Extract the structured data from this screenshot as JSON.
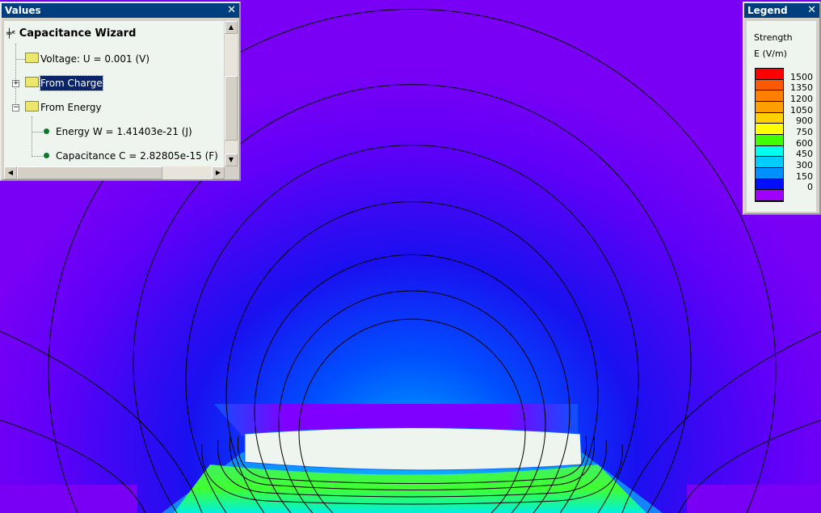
{
  "values_panel": {
    "title": "Values",
    "root": "Capacitance Wizard",
    "root_icon": "capacitor-icon",
    "items": [
      {
        "label": "Voltage: U = 0.001 (V)",
        "icon": "folder-icon"
      },
      {
        "label": "From Charge",
        "icon": "folder-icon",
        "expander": "+",
        "selected": true
      },
      {
        "label": "From Energy",
        "icon": "folder-open-icon",
        "expander": "−"
      },
      {
        "label": "Energy W = 1.41403e-21 (J)",
        "icon": "dot-icon"
      },
      {
        "label": "Capacitance C = 2.82805e-15 (F)",
        "icon": "dot-icon"
      }
    ]
  },
  "legend": {
    "title": "Legend",
    "quantity": "Strength",
    "unit": "E (V/m)",
    "ticks": [
      "1500",
      "1350",
      "1200",
      "1050",
      "900",
      "750",
      "600",
      "450",
      "300",
      "150",
      "0"
    ],
    "colors": [
      "#ff0000",
      "#ff5a00",
      "#ff8000",
      "#ffa000",
      "#ffd000",
      "#ffff00",
      "#40ff00",
      "#00ffee",
      "#00ccff",
      "#0090ff",
      "#0010ff",
      "#a000ff"
    ]
  }
}
